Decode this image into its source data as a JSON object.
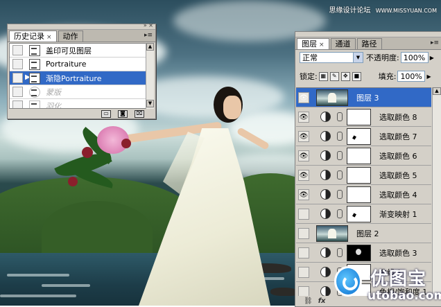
{
  "watermark": {
    "site_cn": "思缘设计论坛",
    "site_url": "WWW.MISSYUAN.COM"
  },
  "history_panel": {
    "tabs": [
      {
        "label": "历史记录",
        "close": "×",
        "active": true
      },
      {
        "label": "动作",
        "active": false
      }
    ],
    "items": [
      {
        "label": "盖印可见图层",
        "state": "normal"
      },
      {
        "label": "Portraiture",
        "state": "normal"
      },
      {
        "label": "渐隐Portraiture",
        "state": "selected"
      },
      {
        "label": "蒙版",
        "state": "dimmed"
      },
      {
        "label": "羽化",
        "state": "dimmed"
      }
    ]
  },
  "layers_panel": {
    "tabs": [
      {
        "label": "图层",
        "close": "×",
        "active": true
      },
      {
        "label": "通道",
        "active": false
      },
      {
        "label": "路径",
        "active": false
      }
    ],
    "blend_mode": "正常",
    "opacity_label": "不透明度:",
    "opacity_value": "100%",
    "lock_label": "锁定:",
    "fill_label": "填充:",
    "fill_value": "100%",
    "layers": [
      {
        "name": "图层 3",
        "kind": "pixel",
        "visible": true,
        "selected": true
      },
      {
        "name": "选取颜色 8",
        "kind": "adjust",
        "mask": "white",
        "visible": true
      },
      {
        "name": "选取颜色 7",
        "kind": "adjust",
        "mask": "speck",
        "visible": true
      },
      {
        "name": "选取颜色 6",
        "kind": "adjust",
        "mask": "white",
        "visible": true
      },
      {
        "name": "选取颜色 5",
        "kind": "adjust",
        "mask": "white",
        "visible": true
      },
      {
        "name": "选取颜色 4",
        "kind": "adjust",
        "mask": "white",
        "visible": true
      },
      {
        "name": "渐变映射 1",
        "kind": "adjust",
        "mask": "speck",
        "visible": false
      },
      {
        "name": "图层 2",
        "kind": "pixel",
        "visible": false
      },
      {
        "name": "选取颜色 3",
        "kind": "adjust",
        "mask": "dark",
        "visible": false
      },
      {
        "name": "曲线 1",
        "kind": "adjust",
        "mask": "white",
        "visible": false
      },
      {
        "name": "色相/饱和度 1",
        "kind": "adjust",
        "mask": "white",
        "visible": false
      }
    ],
    "footer_icons": [
      "link-icon",
      "fx-icon"
    ],
    "footer_fx": "fx"
  },
  "logo": {
    "name_cn": "优图宝",
    "url": "utobao.com"
  },
  "colors": {
    "selection": "#3169c6",
    "panel_bg": "#d4d0c8"
  }
}
